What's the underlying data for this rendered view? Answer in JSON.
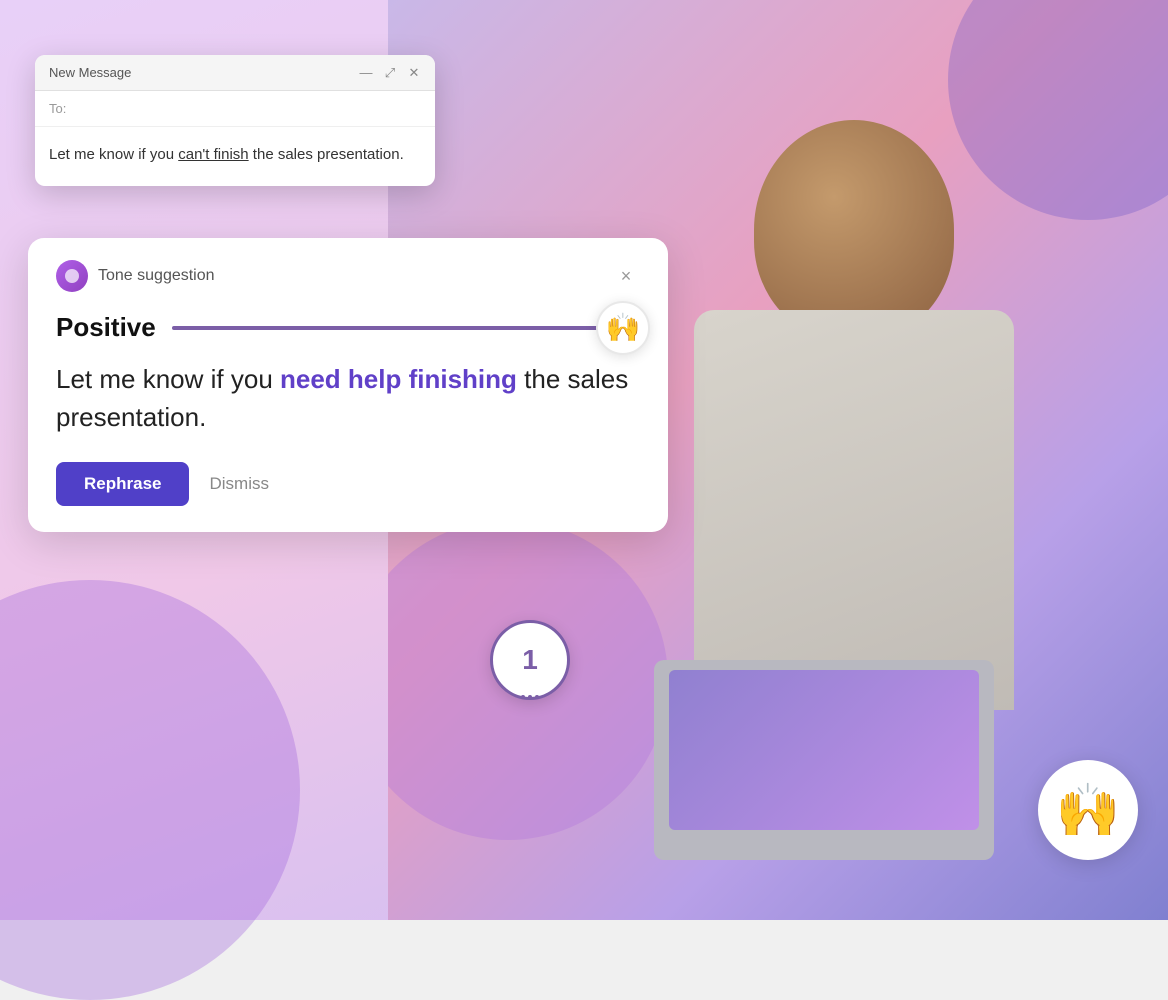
{
  "scene": {
    "background": {
      "leftColor": "#e8d0f8",
      "rightColor": "#c9b8e8"
    }
  },
  "emailWindow": {
    "title": "New Message",
    "toLabel": "To:",
    "bodyText": "Let me know if you can't finish the sales presentation.",
    "bodyPart1": "Let me know if you ",
    "bodyUnderline": "can't finish",
    "bodyPart2": " the sales presentation.",
    "controls": {
      "minimize": "—",
      "maximize": "⤢",
      "close": "✕"
    }
  },
  "toneCard": {
    "headerLabel": "Tone suggestion",
    "closeIcon": "×",
    "toneName": "Positive",
    "emoji": "🙌",
    "sliderEmoji": "🙌",
    "suggestionPart1": "Let me know if you ",
    "suggestionHighlight": "need help finishing",
    "suggestionPart2": " the sales presentation.",
    "rephraseLabel": "Rephrase",
    "dismissLabel": "Dismiss"
  },
  "badge": {
    "number": "1"
  },
  "bottomEmoji": {
    "icon": "🙌"
  }
}
